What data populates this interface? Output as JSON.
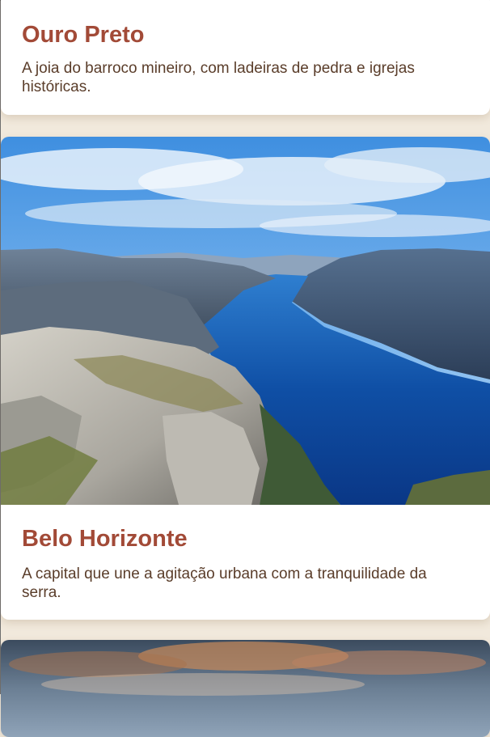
{
  "cards": [
    {
      "title": "Ouro Preto",
      "text": "A joia do barroco mineiro, com ladeiras de pedra e igrejas históricas."
    },
    {
      "title": "Belo Horizonte",
      "text": "A capital que une a agitação urbana com a tranquilidade da serra.",
      "image": "fjord-landscape-photo"
    },
    {
      "image": "sunset-sky-photo"
    }
  ],
  "colors": {
    "page_background": "#f1e9dc",
    "card_background": "#ffffff",
    "title": "#a24a37",
    "text": "#5a3d2a"
  }
}
